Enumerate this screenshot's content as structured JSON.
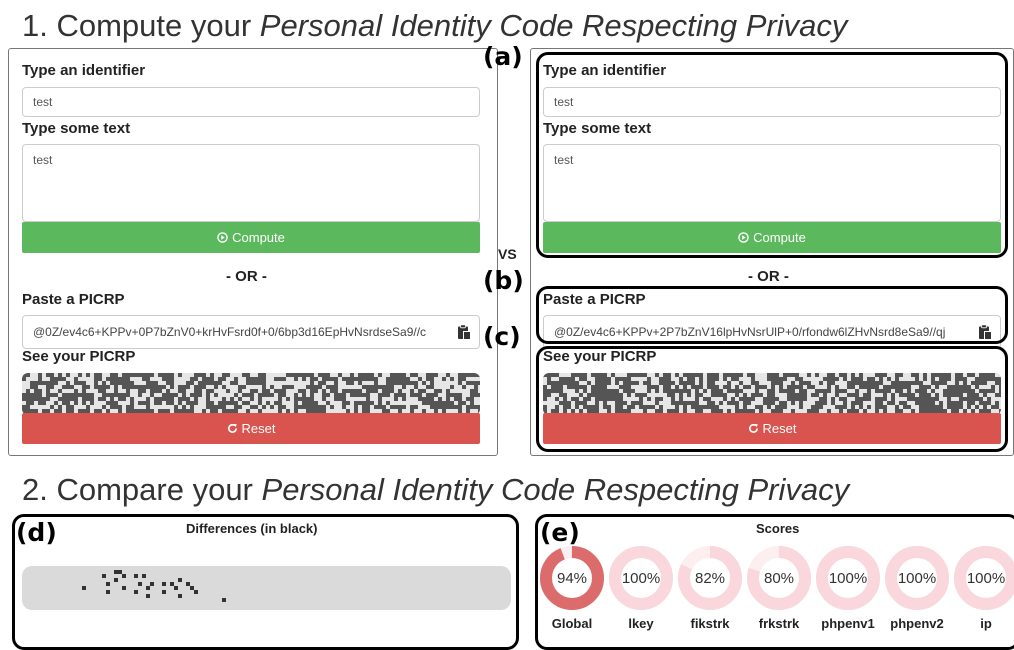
{
  "section1": {
    "number": "1. Compute your",
    "italic": "Personal Identity Code Respecting Privacy"
  },
  "section2": {
    "number": "2. Compare your",
    "italic": "Personal Identity Code Respecting Privacy"
  },
  "left": {
    "identifier_label": "Type an identifier",
    "identifier_value": "test",
    "text_label": "Type some text",
    "text_value": "test",
    "compute_label": "Compute",
    "or_text": "- OR -",
    "paste_label": "Paste a PICRP",
    "paste_value": "@0Z/ev4c6+KPPv+0P7bZnV0+krHvFsrd0f+0/6bp3d16EpHvNsrdseSa9//c",
    "see_label": "See your PICRP",
    "reset_label": "Reset"
  },
  "right": {
    "identifier_label": "Type an identifier",
    "identifier_value": "test",
    "text_label": "Type some text",
    "text_value": "test",
    "compute_label": "Compute",
    "or_text": "- OR -",
    "paste_label": "Paste a PICRP",
    "paste_value": "@0Z/ev4c6+KPPv+2P7bZnV16lpHvNsrUlP+0/rfondw6lZHvNsrd8eSa9//qj",
    "see_label": "See your PICRP",
    "reset_label": "Reset"
  },
  "vs_text": "VS",
  "annotations": {
    "a": "(a)",
    "b": "(b)",
    "c": "(c)",
    "d": "(d)",
    "e": "(e)"
  },
  "differences_title": "Differences (in black)",
  "scores_title": "Scores",
  "scores": [
    {
      "label": "Global",
      "value": "94%",
      "fraction": 0.94
    },
    {
      "label": "lkey",
      "value": "100%",
      "fraction": 1.0
    },
    {
      "label": "fikstrk",
      "value": "82%",
      "fraction": 0.82
    },
    {
      "label": "frkstrk",
      "value": "80%",
      "fraction": 0.8
    },
    {
      "label": "phpenv1",
      "value": "100%",
      "fraction": 1.0
    },
    {
      "label": "phpenv2",
      "value": "100%",
      "fraction": 1.0
    },
    {
      "label": "ip",
      "value": "100%",
      "fraction": 1.0
    }
  ],
  "colors": {
    "green": "#5cb85c",
    "red": "#d9534f",
    "qr_dark": "#555555",
    "qr_light": "#e6e6e6",
    "donut_global": "#dc6b6b",
    "donut_light": "#f9d7dc",
    "donut_track": "#fdeef0"
  },
  "icons": {
    "compute": "play-circle-icon",
    "reset": "refresh-icon",
    "paste": "clipboard-icon"
  }
}
